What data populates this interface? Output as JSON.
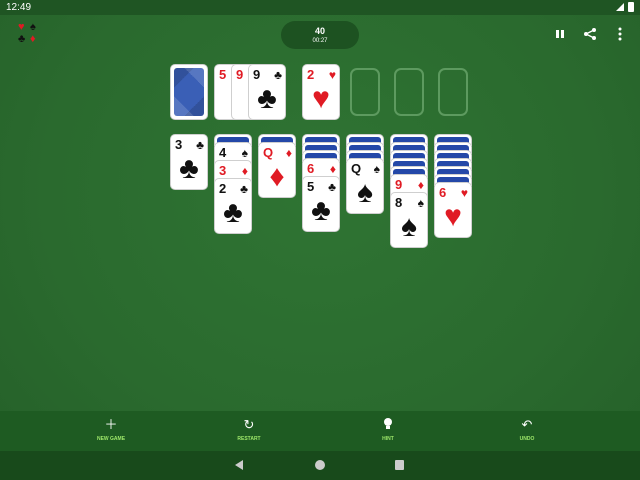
{
  "status": {
    "time": "12:49"
  },
  "header": {
    "score": "40",
    "timer": "00:27"
  },
  "waste": [
    {
      "rank": "5",
      "suit": "♥",
      "color": "red"
    },
    {
      "rank": "9",
      "suit": "♥",
      "color": "red"
    },
    {
      "rank": "9",
      "suit": "♣",
      "color": "black"
    }
  ],
  "foundations": [
    {
      "rank": "2",
      "suit": "♥",
      "color": "red"
    }
  ],
  "tableau": [
    {
      "hidden": 0,
      "cards": [
        {
          "rank": "3",
          "suit": "♣",
          "color": "black"
        }
      ]
    },
    {
      "hidden": 1,
      "cards": [
        {
          "rank": "4",
          "suit": "♠",
          "color": "black"
        },
        {
          "rank": "3",
          "suit": "♦",
          "color": "red"
        },
        {
          "rank": "2",
          "suit": "♣",
          "color": "black"
        }
      ]
    },
    {
      "hidden": 1,
      "cards": [
        {
          "rank": "Q",
          "suit": "♦",
          "color": "red"
        }
      ]
    },
    {
      "hidden": 3,
      "cards": [
        {
          "rank": "6",
          "suit": "♦",
          "color": "red"
        },
        {
          "rank": "5",
          "suit": "♣",
          "color": "black"
        }
      ]
    },
    {
      "hidden": 3,
      "cards": [
        {
          "rank": "Q",
          "suit": "♠",
          "color": "black"
        }
      ]
    },
    {
      "hidden": 5,
      "cards": [
        {
          "rank": "9",
          "suit": "♦",
          "color": "red"
        },
        {
          "rank": "8",
          "suit": "♠",
          "color": "black"
        }
      ]
    },
    {
      "hidden": 6,
      "cards": [
        {
          "rank": "6",
          "suit": "♥",
          "color": "red"
        }
      ]
    }
  ],
  "toolbar": {
    "new_game": "NEW GAME",
    "restart": "RESTART",
    "hint": "HINT",
    "undo": "UNDO"
  },
  "colors": {
    "felt": "#2b6b2f",
    "red": "#e01b24",
    "accent": "#9ee86a"
  },
  "icons": {
    "pause": "pause-icon",
    "share": "share-icon",
    "more": "more-vert-icon",
    "new_game": "plus-icon",
    "restart": "restart-icon",
    "hint": "lightbulb-icon",
    "undo": "undo-icon"
  }
}
